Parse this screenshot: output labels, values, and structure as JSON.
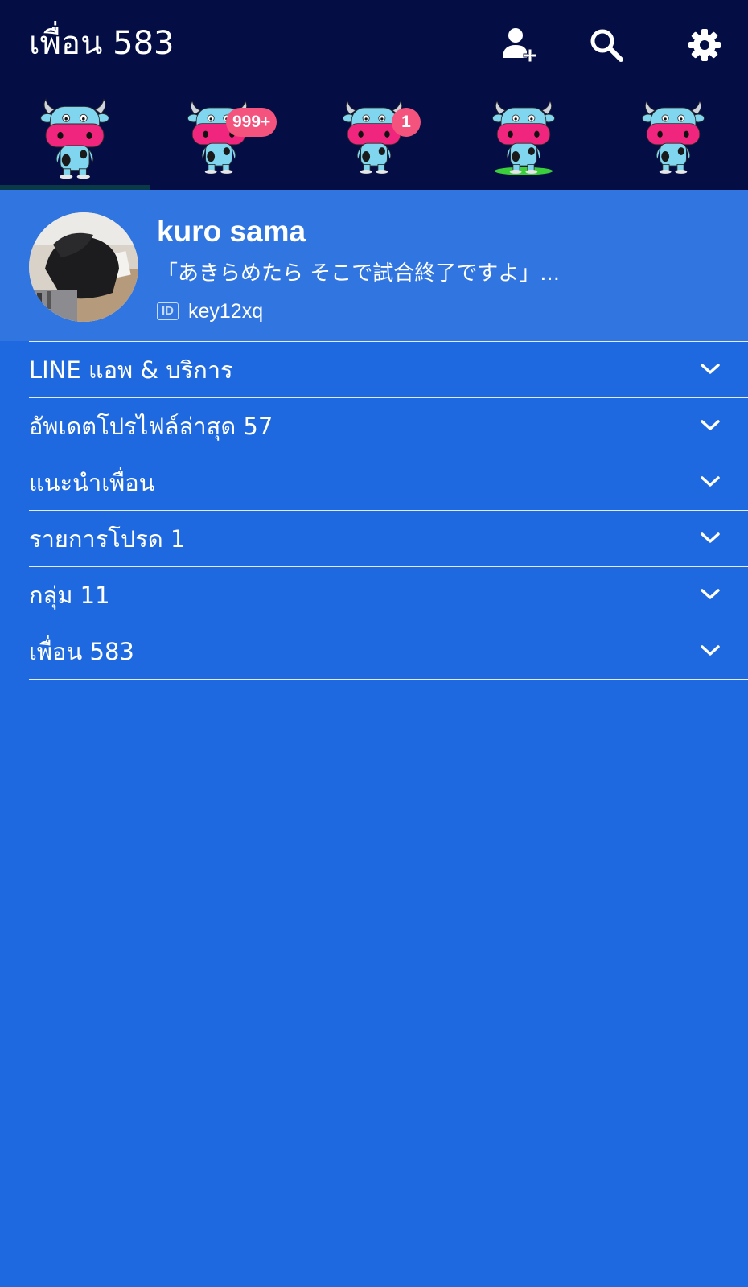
{
  "header": {
    "title": "เพื่อน 583",
    "icons": [
      "add-friend-icon",
      "search-icon",
      "settings-icon"
    ]
  },
  "tabs": [
    {
      "name": "friends",
      "badge": ""
    },
    {
      "name": "chats",
      "badge": "999+"
    },
    {
      "name": "timeline",
      "badge": "1"
    },
    {
      "name": "news",
      "badge": ""
    },
    {
      "name": "more",
      "badge": ""
    }
  ],
  "profile": {
    "name": "kuro sama",
    "status": "「あきらめたら そこで試合終了ですよ」...",
    "id_chip": "ID",
    "id": "key12xq"
  },
  "sections": [
    {
      "label": "LINE แอพ & บริการ"
    },
    {
      "label": "อัพเดตโปรไฟล์ล่าสุด 57"
    },
    {
      "label": "แนะนำเพื่อน"
    },
    {
      "label": "รายการโปรด 1"
    },
    {
      "label": "กลุ่ม 11"
    },
    {
      "label": "เพื่อน 583"
    }
  ],
  "colors": {
    "header_bg": "#040e45",
    "body_bg": "#1e69df",
    "profile_bg": "#3176e0",
    "badge": "#f4537d",
    "cow_body": "#7fd6ee",
    "cow_snout": "#f0267e"
  }
}
